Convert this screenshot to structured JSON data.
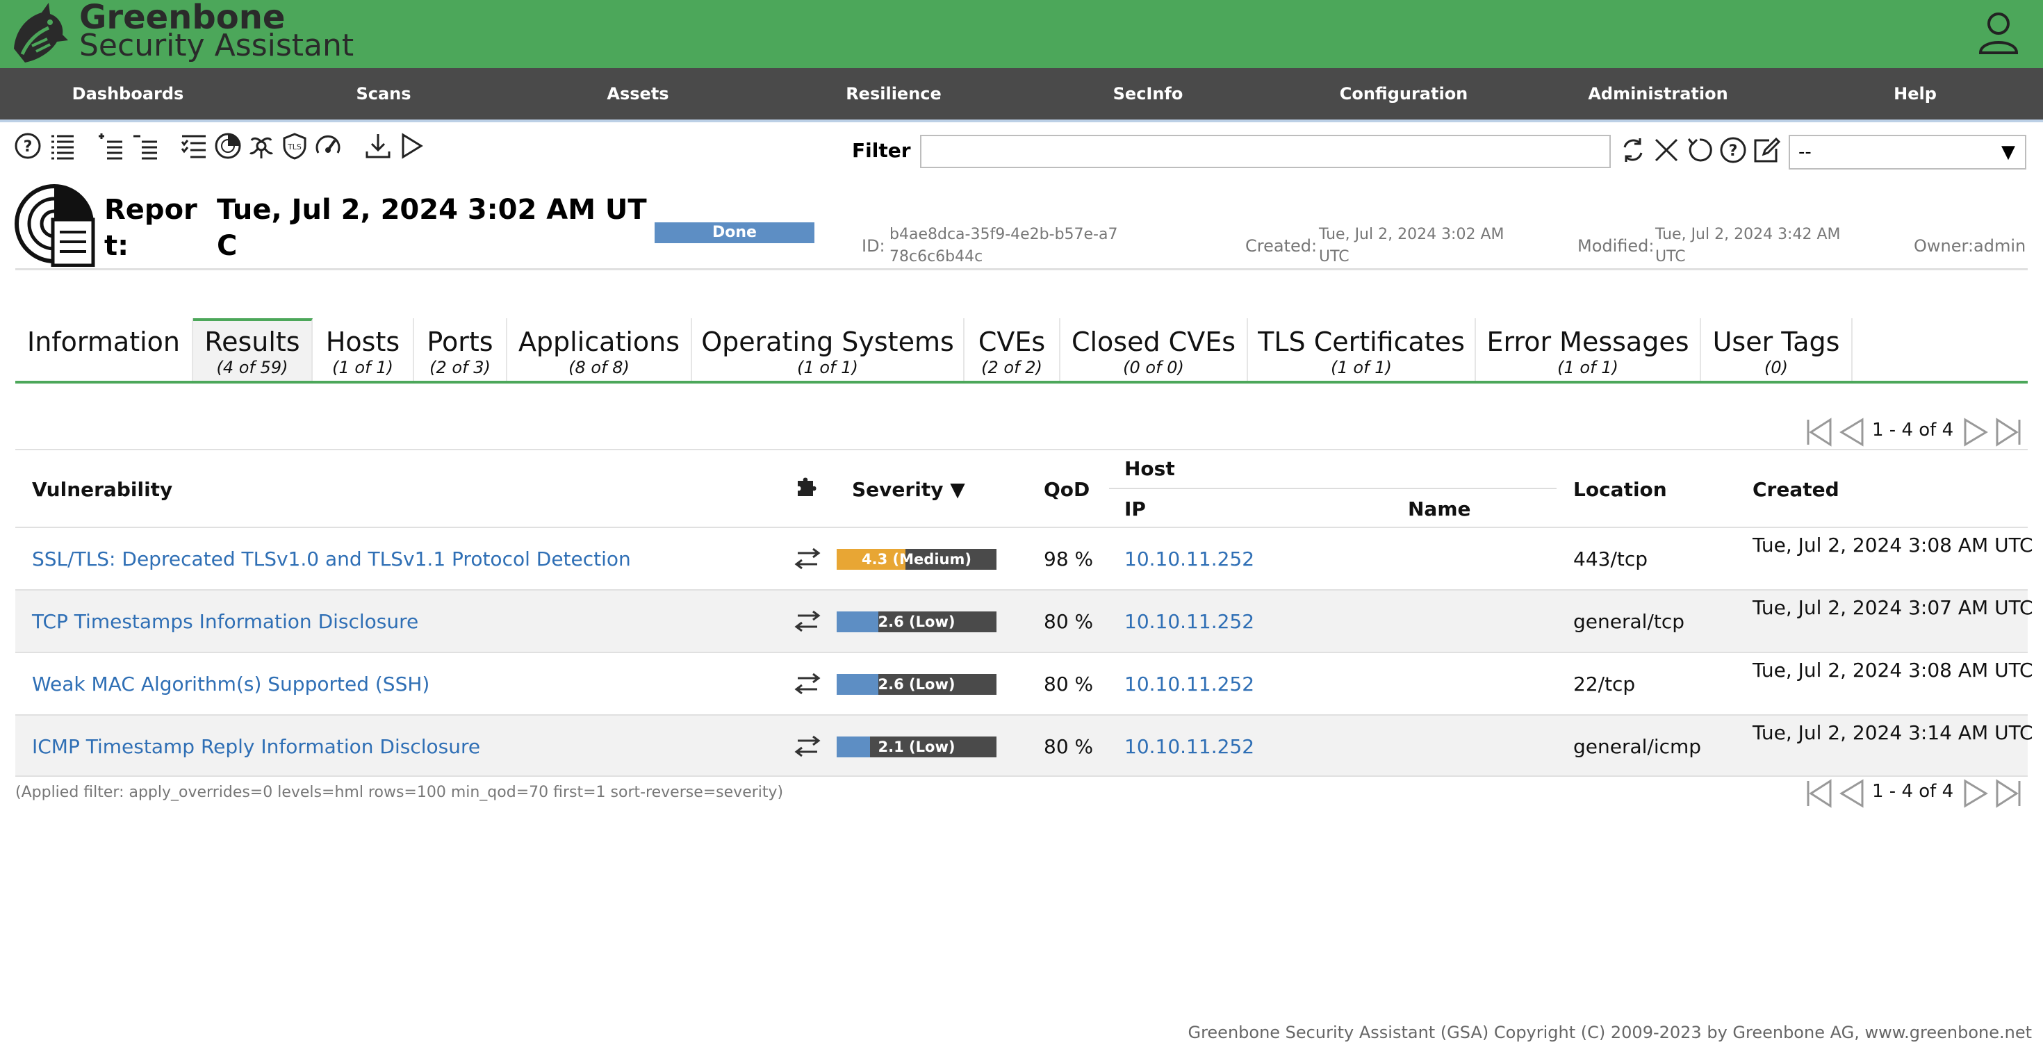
{
  "header": {
    "brand_line1": "Greenbone",
    "brand_line2": "Security Assistant",
    "logo_icon": "greenbone-dragon-logo",
    "user_icon": "user-icon"
  },
  "menu": {
    "items": [
      "Dashboards",
      "Scans",
      "Assets",
      "Resilience",
      "SecInfo",
      "Configuration",
      "Administration",
      "Help"
    ]
  },
  "toolbar": {
    "icons": [
      "help-icon",
      "list-icon",
      "add-to-assets-icon",
      "remove-from-assets-icon",
      "task-details-icon",
      "delta-report-icon",
      "tls-certificate-icon",
      "vulnerabilities-icon",
      "performance-icon",
      "download-icon",
      "trigger-alert-icon"
    ]
  },
  "filter": {
    "label": "Filter",
    "value": "",
    "select_value": "--",
    "icons": [
      "refresh-icon",
      "clear-icon",
      "reset-icon",
      "help-icon",
      "edit-filter-icon"
    ]
  },
  "report": {
    "title_label": "Report:",
    "title_date": "Tue, Jul 2, 2024 3:02 AM UTC",
    "status": "Done",
    "id_label": "ID:",
    "id_value": "b4ae8dca-35f9-4e2b-b57e-a778c6c6b44c",
    "created_label": "Created:",
    "created_value": "Tue, Jul 2, 2024 3:02 AM UTC",
    "modified_label": "Modified:",
    "modified_value": "Tue, Jul 2, 2024 3:42 AM UTC",
    "owner_label": "Owner:",
    "owner_value": "admin"
  },
  "tabs": [
    {
      "label": "Information",
      "count": ""
    },
    {
      "label": "Results",
      "count": "(4 of 59)"
    },
    {
      "label": "Hosts",
      "count": "(1 of 1)"
    },
    {
      "label": "Ports",
      "count": "(2 of 3)"
    },
    {
      "label": "Applications",
      "count": "(8 of 8)"
    },
    {
      "label": "Operating Systems",
      "count": "(1 of 1)"
    },
    {
      "label": "CVEs",
      "count": "(2 of 2)"
    },
    {
      "label": "Closed CVEs",
      "count": "(0 of 0)"
    },
    {
      "label": "TLS Certificates",
      "count": "(1 of 1)"
    },
    {
      "label": "Error Messages",
      "count": "(1 of 1)"
    },
    {
      "label": "User Tags",
      "count": "(0)"
    }
  ],
  "pagination": {
    "text": "1 - 4 of 4"
  },
  "table": {
    "headers": {
      "vulnerability": "Vulnerability",
      "severity": "Severity ▼",
      "qod": "QoD",
      "host": "Host",
      "ip": "IP",
      "name": "Name",
      "location": "Location",
      "created": "Created"
    },
    "rows": [
      {
        "vulnerability": "SSL/TLS: Deprecated TLSv1.0 and TLSv1.1 Protocol Detection",
        "severity_label": "4.3 (Medium)",
        "severity_score": 4.3,
        "severity_color": "#e8a634",
        "qod": "98 %",
        "ip": "10.10.11.252",
        "name": "",
        "location": "443/tcp",
        "created": "Tue, Jul 2, 2024 3:08 AM UTC"
      },
      {
        "vulnerability": "TCP Timestamps Information Disclosure",
        "severity_label": "2.6 (Low)",
        "severity_score": 2.6,
        "severity_color": "#5d8ec4",
        "qod": "80 %",
        "ip": "10.10.11.252",
        "name": "",
        "location": "general/tcp",
        "created": "Tue, Jul 2, 2024 3:07 AM UTC"
      },
      {
        "vulnerability": "Weak MAC Algorithm(s) Supported (SSH)",
        "severity_label": "2.6 (Low)",
        "severity_score": 2.6,
        "severity_color": "#5d8ec4",
        "qod": "80 %",
        "ip": "10.10.11.252",
        "name": "",
        "location": "22/tcp",
        "created": "Tue, Jul 2, 2024 3:08 AM UTC"
      },
      {
        "vulnerability": "ICMP Timestamp Reply Information Disclosure",
        "severity_label": "2.1 (Low)",
        "severity_score": 2.1,
        "severity_color": "#5d8ec4",
        "qod": "80 %",
        "ip": "10.10.11.252",
        "name": "",
        "location": "general/icmp",
        "created": "Tue, Jul 2, 2024 3:14 AM UTC"
      }
    ]
  },
  "applied_filter": "(Applied filter: apply_overrides=0 levels=hml rows=100 min_qod=70 first=1 sort-reverse=severity)",
  "footer": "Greenbone Security Assistant (GSA) Copyright (C) 2009-2023 by Greenbone AG, www.greenbone.net"
}
